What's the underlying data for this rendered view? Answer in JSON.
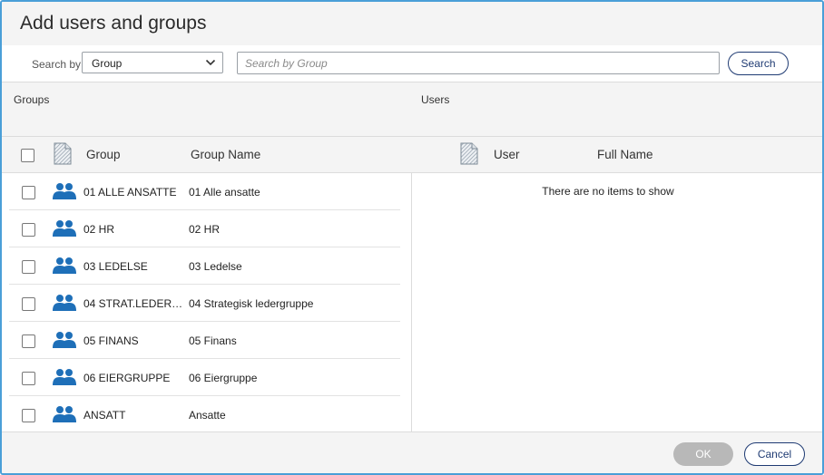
{
  "dialog": {
    "title": "Add users and groups"
  },
  "search": {
    "label": "Search by",
    "select_value": "Group",
    "placeholder": "Search by Group",
    "input_value": "",
    "button_label": "Search"
  },
  "panels": {
    "groups_title": "Groups",
    "users_title": "Users"
  },
  "groups_table": {
    "columns": [
      "Group",
      "Group Name"
    ],
    "rows": [
      {
        "group": "01 ALLE ANSATTE",
        "name": "01 Alle ansatte"
      },
      {
        "group": "02 HR",
        "name": "02 HR"
      },
      {
        "group": "03 LEDELSE",
        "name": "03 Ledelse"
      },
      {
        "group": "04 STRAT.LEDER…",
        "name": "04 Strategisk ledergruppe"
      },
      {
        "group": "05 FINANS",
        "name": "05 Finans"
      },
      {
        "group": "06 EIERGRUPPE",
        "name": "06 Eiergruppe"
      },
      {
        "group": "ANSATT",
        "name": "Ansatte"
      }
    ]
  },
  "users_table": {
    "columns": [
      "User",
      "Full Name"
    ],
    "empty_message": "There are no items to show"
  },
  "footer": {
    "ok_label": "OK",
    "cancel_label": "Cancel"
  },
  "colors": {
    "accent": "#1f3b73",
    "border": "#4a9fd8",
    "group_icon": "#1e6fb8",
    "disabled_button": "#b8b8b8"
  },
  "icons": {
    "group_row": "people-icon",
    "column_select": "document-icon",
    "dropdown": "chevron-down-icon"
  }
}
